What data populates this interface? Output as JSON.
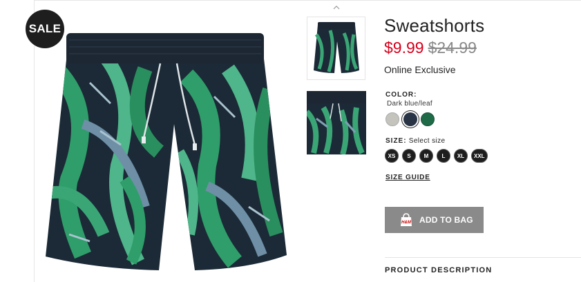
{
  "badge": {
    "sale": "SALE"
  },
  "product": {
    "title": "Sweatshorts",
    "price_sale": "$9.99",
    "price_original": "$24.99",
    "exclusive": "Online Exclusive"
  },
  "color": {
    "label": "COLOR:",
    "selected_name": "Dark blue/leaf",
    "swatches": [
      {
        "name": "light gray",
        "hex": "#c4c4bd"
      },
      {
        "name": "dark blue/leaf",
        "hex": "#283445",
        "selected": true
      },
      {
        "name": "green",
        "hex": "#1f6a47"
      }
    ]
  },
  "size": {
    "label": "SIZE:",
    "hint": "Select size",
    "options": [
      "XS",
      "S",
      "M",
      "L",
      "XL",
      "XXL"
    ]
  },
  "links": {
    "size_guide": "SIZE GUIDE"
  },
  "actions": {
    "add_to_bag": "ADD TO BAG",
    "bag_logo": "H&M"
  },
  "sections": {
    "product_description": "PRODUCT DESCRIPTION"
  },
  "icons": [
    "chevron-up-icon",
    "shopping-bag-icon"
  ],
  "colors": {
    "sale_price": "#d6001c",
    "button_bg": "#8a8a8a",
    "badge_bg": "#1e1e1e"
  }
}
